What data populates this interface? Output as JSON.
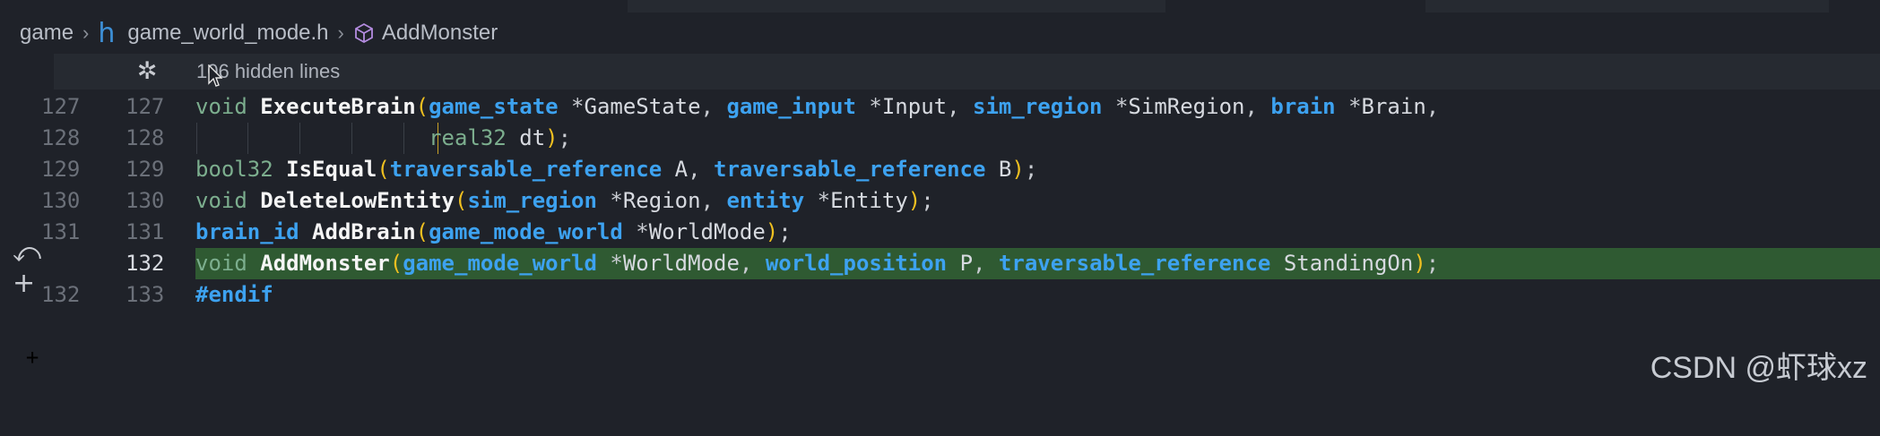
{
  "breadcrumb": {
    "root": "game",
    "file": "game_world_mode.h",
    "symbol": "AddMonster",
    "file_icon": "h-header-icon",
    "symbol_icon": "cube-icon"
  },
  "hidden_lines": {
    "label": "106 hidden lines",
    "icon": "gear-icon"
  },
  "lines": [
    {
      "old": "127",
      "new": "127",
      "code": "void ExecuteBrain(game_state *GameState, game_input *Input, sim_region *SimRegion, brain *Brain,"
    },
    {
      "old": "128",
      "new": "128",
      "code": "                  real32 dt);"
    },
    {
      "old": "129",
      "new": "129",
      "code": "bool32 IsEqual(traversable_reference A, traversable_reference B);"
    },
    {
      "old": "130",
      "new": "130",
      "code": "void DeleteLowEntity(sim_region *Region, entity *Entity);"
    },
    {
      "old": "131",
      "new": "131",
      "code": "brain_id AddBrain(game_mode_world *WorldMode);"
    },
    {
      "old": "",
      "new": "132",
      "marker": "+",
      "code": "void AddMonster(game_mode_world *WorldMode, world_position P, traversable_reference StandingOn);"
    },
    {
      "old": "132",
      "new": "133",
      "code": "#endif"
    }
  ],
  "side_icons": [
    "revert-icon",
    "stage-plus-icon"
  ],
  "watermark": "CSDN @虾球xz",
  "colors": {
    "background": "#1f2229",
    "added_line": "#2f5a32",
    "type": "#3da2f0",
    "keyword": "#7cae8e",
    "paren": "#f0c020"
  }
}
